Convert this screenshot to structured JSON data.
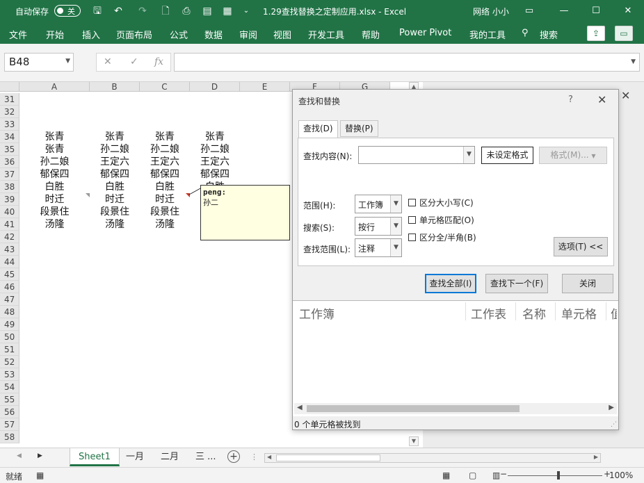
{
  "titlebar": {
    "autosave_label": "自动保存",
    "autosave_state": "关",
    "doc_title": "1.29查找替换之定制应用.xlsx  -  Excel",
    "user": "网络 小小"
  },
  "ribbon": {
    "tabs": [
      "文件",
      "开始",
      "插入",
      "页面布局",
      "公式",
      "数据",
      "审阅",
      "视图",
      "开发工具",
      "帮助",
      "Power Pivot",
      "我的工具",
      "搜索"
    ]
  },
  "formula_bar": {
    "name_box": "B48",
    "cancel": "✕",
    "enter": "✓",
    "fx": "fx",
    "formula": ""
  },
  "sheet": {
    "columns": [
      "A",
      "B",
      "C",
      "D",
      "E",
      "F",
      "G"
    ],
    "rows": [
      "31",
      "32",
      "33",
      "34",
      "35",
      "36",
      "37",
      "38",
      "39",
      "40",
      "41",
      "42",
      "43",
      "44",
      "45",
      "46",
      "47",
      "48",
      "49",
      "50",
      "51",
      "52",
      "53",
      "54",
      "55",
      "56",
      "57",
      "58"
    ],
    "col_a": [
      "张青",
      "张青",
      "孙二娘",
      "郁保四",
      "白胜",
      "时迁",
      "段景住",
      "汤隆"
    ],
    "col_b": [
      "张青",
      "孙二娘",
      "王定六",
      "郁保四",
      "白胜",
      "时迁",
      "段景住",
      "汤隆"
    ],
    "col_c": [
      "张青",
      "孙二娘",
      "王定六",
      "郁保四",
      "白胜",
      "时迁",
      "段景住",
      "汤隆"
    ],
    "col_d": [
      "张青",
      "孙二娘",
      "王定六",
      "郁保四",
      "白胜"
    ],
    "comment_author": "peng:",
    "comment_text": "孙二"
  },
  "sheet_tabs": [
    "Sheet1",
    "一月",
    "二月",
    "三 ..."
  ],
  "status": {
    "mode": "就绪",
    "zoom": "100%"
  },
  "dialog": {
    "title": "查找和替换",
    "help": "?",
    "tab_find": "查找(D)",
    "tab_replace": "替换(P)",
    "find_label": "查找内容(N):",
    "find_value": "",
    "no_format": "未设定格式",
    "format_btn": "格式(M)...",
    "scope_label": "范围(H):",
    "scope_value": "工作簿",
    "search_label": "搜索(S):",
    "search_value": "按行",
    "lookin_label": "查找范围(L):",
    "lookin_value": "注释",
    "match_case": "区分大小写(C)",
    "match_entire": "单元格匹配(O)",
    "match_byte": "区分全/半角(B)",
    "options_btn": "选项(T) <<",
    "find_all": "查找全部(I)",
    "find_next": "查找下一个(F)",
    "close": "关闭",
    "result_headers": [
      "工作簿",
      "工作表",
      "名称",
      "单元格",
      "值"
    ],
    "status_text": "0 个单元格被找到"
  },
  "colors": {
    "excel_green": "#217346",
    "dialog_bg": "#f0f0f0",
    "comment_bg": "#ffffe1",
    "primary_border": "#0078d7"
  }
}
